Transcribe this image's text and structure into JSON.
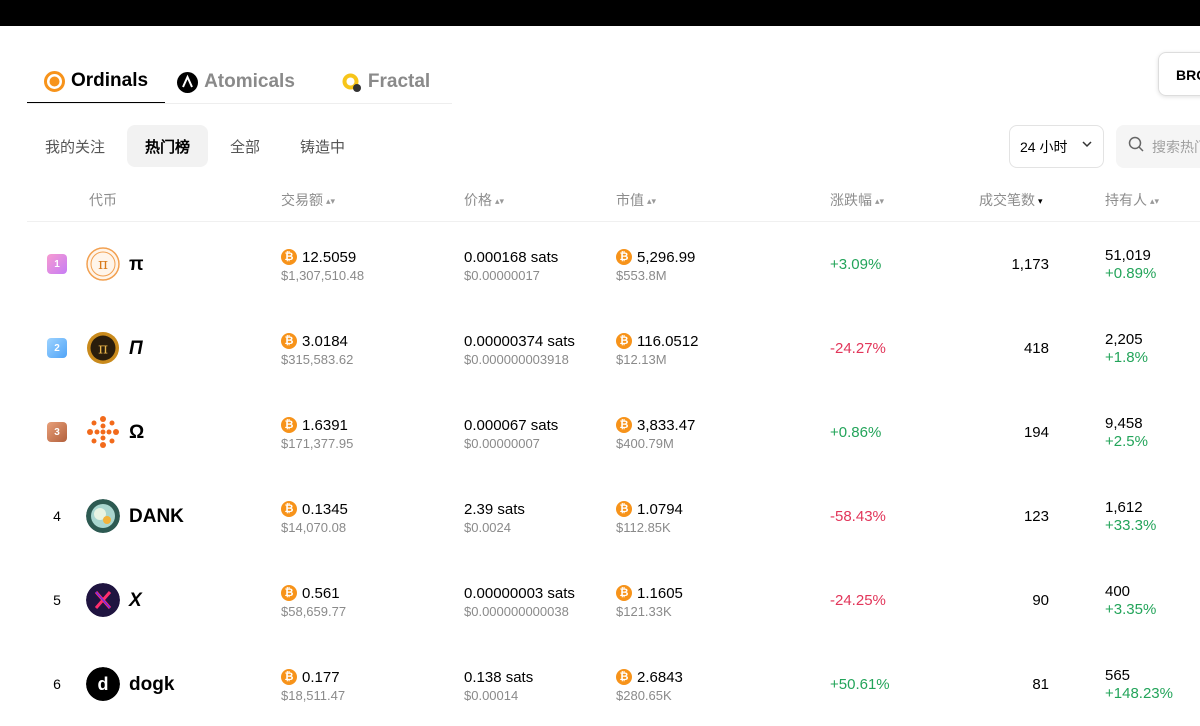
{
  "tabs": [
    {
      "label": "Ordinals",
      "icon": "ordinals-icon",
      "active": true
    },
    {
      "label": "Atomicals",
      "icon": "atomicals-icon",
      "active": false
    },
    {
      "label": "Fractal",
      "icon": "fractal-icon",
      "active": false
    }
  ],
  "brc_button": "BRC",
  "subtabs": [
    {
      "label": "我的关注",
      "active": false
    },
    {
      "label": "热门榜",
      "active": true
    },
    {
      "label": "全部",
      "active": false
    },
    {
      "label": "铸造中",
      "active": false
    }
  ],
  "period": {
    "value": "24 小时"
  },
  "search": {
    "placeholder": "搜索热门"
  },
  "columns": {
    "token": "代币",
    "volume": "交易额",
    "price": "价格",
    "market_cap": "市值",
    "change": "涨跌幅",
    "tx_count": "成交笔数",
    "holders": "持有人"
  },
  "sort_active_column": "tx_count",
  "colors": {
    "positive": "#23a45a",
    "negative": "#e2365a",
    "btc": "#f7931a",
    "accent": "#f7931a"
  },
  "rows": [
    {
      "rank": "1",
      "medal": "1",
      "name": "π",
      "avatar": "pi-circle-icon",
      "volume_btc": "12.5059",
      "volume_usd": "$1,307,510.48",
      "price_sats": "0.000168 sats",
      "price_usd": "$0.00000017",
      "mcap_btc": "5,296.99",
      "mcap_usd": "$553.8M",
      "change": "+3.09%",
      "change_dir": "pos",
      "tx_count": "1,173",
      "holders": "51,019",
      "holders_change": "+0.89%"
    },
    {
      "rank": "2",
      "medal": "2",
      "name": "Π",
      "avatar": "pi-dark-icon",
      "volume_btc": "3.0184",
      "volume_usd": "$315,583.62",
      "price_sats": "0.00000374 sats",
      "price_usd": "$0.000000003918",
      "mcap_btc": "116.0512",
      "mcap_usd": "$12.13M",
      "change": "-24.27%",
      "change_dir": "neg",
      "tx_count": "418",
      "holders": "2,205",
      "holders_change": "+1.8%"
    },
    {
      "rank": "3",
      "medal": "3",
      "name": "Ω",
      "avatar": "omega-dots-icon",
      "volume_btc": "1.6391",
      "volume_usd": "$171,377.95",
      "price_sats": "0.000067 sats",
      "price_usd": "$0.00000007",
      "mcap_btc": "3,833.47",
      "mcap_usd": "$400.79M",
      "change": "+0.86%",
      "change_dir": "pos",
      "tx_count": "194",
      "holders": "9,458",
      "holders_change": "+2.5%"
    },
    {
      "rank": "4",
      "medal": "",
      "name": "DANK",
      "avatar": "dank-icon",
      "volume_btc": "0.1345",
      "volume_usd": "$14,070.08",
      "price_sats": "2.39 sats",
      "price_usd": "$0.0024",
      "mcap_btc": "1.0794",
      "mcap_usd": "$112.85K",
      "change": "-58.43%",
      "change_dir": "neg",
      "tx_count": "123",
      "holders": "1,612",
      "holders_change": "+33.3%"
    },
    {
      "rank": "5",
      "medal": "",
      "name": "X",
      "avatar": "x-icon",
      "volume_btc": "0.561",
      "volume_usd": "$58,659.77",
      "price_sats": "0.00000003 sats",
      "price_usd": "$0.000000000038",
      "mcap_btc": "1.1605",
      "mcap_usd": "$121.33K",
      "change": "-24.25%",
      "change_dir": "neg",
      "tx_count": "90",
      "holders": "400",
      "holders_change": "+3.35%"
    },
    {
      "rank": "6",
      "medal": "",
      "name": "dogk",
      "avatar": "dogk-icon",
      "volume_btc": "0.177",
      "volume_usd": "$18,511.47",
      "price_sats": "0.138 sats",
      "price_usd": "$0.00014",
      "mcap_btc": "2.6843",
      "mcap_usd": "$280.65K",
      "change": "+50.61%",
      "change_dir": "pos",
      "tx_count": "81",
      "holders": "565",
      "holders_change": "+148.23%"
    }
  ]
}
